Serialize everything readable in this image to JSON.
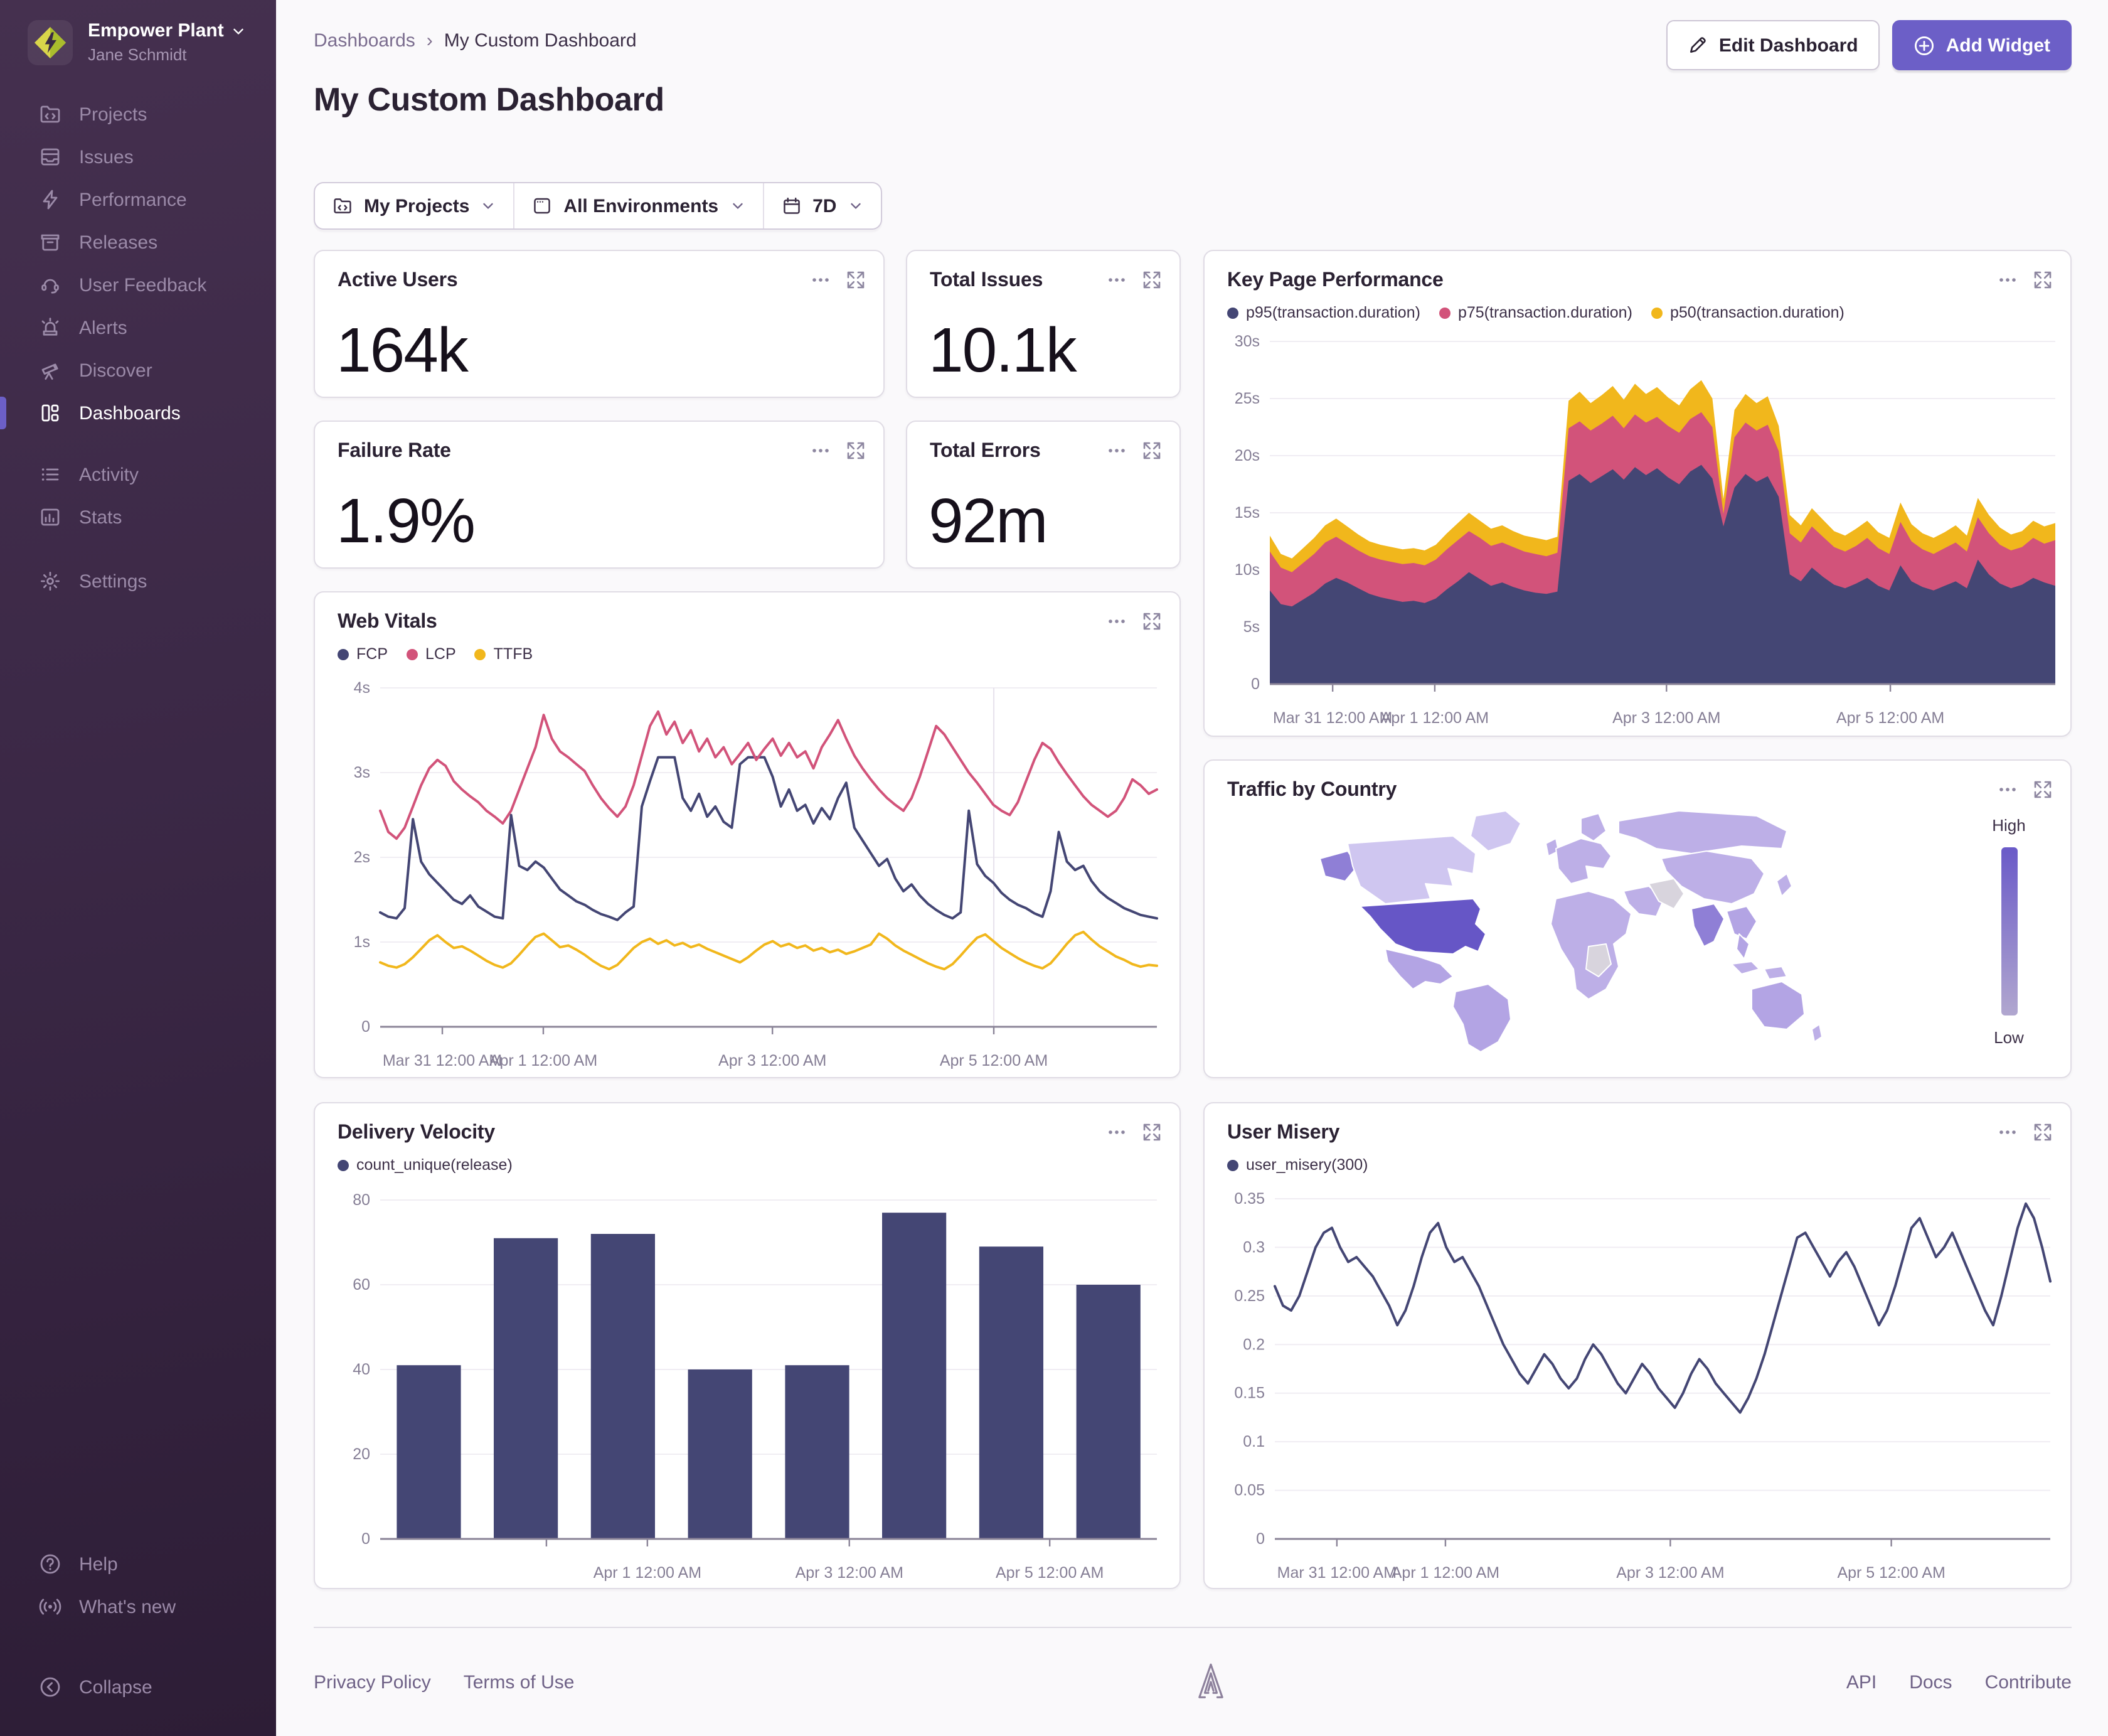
{
  "colors": {
    "accent": "#6c5fc7",
    "text": "#2b2233",
    "muted": "#80708f",
    "link": "#7b6d8f",
    "border": "#e0dce5",
    "axis_label": "#857e95",
    "grid_line": "#f0edf3",
    "baseline": "#8b8498",
    "sb_top": "#45304f",
    "sb_mid": "#3b2846",
    "sb_bottom": "#2d1d36",
    "sb_text": "#9b8aa8",
    "chart_navy": "#444674",
    "chart_pink": "#d2537a",
    "chart_yellow": "#f1b71c",
    "map_none": "#d8d4dd",
    "map_low": "#cfc6f0",
    "map_mid": "#bdafe7",
    "map_mid2": "#b3a4e4",
    "map_high": "#8f7fd6",
    "map_max": "#6656c6",
    "grad_top": "#6a5ac8",
    "grad_bottom": "#b1a7cf"
  },
  "sidebar": {
    "org": "Empower Plant",
    "user": "Jane Schmidt",
    "items": [
      {
        "id": "projects",
        "icon": "folder-code-icon",
        "label": "Projects",
        "active": false
      },
      {
        "id": "issues",
        "icon": "stack-icon",
        "label": "Issues",
        "active": false
      },
      {
        "id": "performance",
        "icon": "lightning-icon",
        "label": "Performance",
        "active": false
      },
      {
        "id": "releases",
        "icon": "archive-icon",
        "label": "Releases",
        "active": false
      },
      {
        "id": "user-feedback",
        "icon": "feedback-icon",
        "label": "User Feedback",
        "active": false
      },
      {
        "id": "alerts",
        "icon": "siren-icon",
        "label": "Alerts",
        "active": false
      },
      {
        "id": "discover",
        "icon": "telescope-icon",
        "label": "Discover",
        "active": false
      },
      {
        "id": "dashboards",
        "icon": "dashboard-icon",
        "label": "Dashboards",
        "active": true
      }
    ],
    "secondary": [
      {
        "id": "activity",
        "icon": "list-icon",
        "label": "Activity",
        "active": false
      },
      {
        "id": "stats",
        "icon": "graph-icon",
        "label": "Stats",
        "active": false
      }
    ],
    "tertiary": [
      {
        "id": "settings",
        "icon": "gear-icon",
        "label": "Settings",
        "active": false
      }
    ],
    "bottom": [
      {
        "id": "help",
        "icon": "help-icon",
        "label": "Help",
        "gap": false
      },
      {
        "id": "whats-new",
        "icon": "broadcast-icon",
        "label": "What's new",
        "gap": false
      },
      {
        "id": "collapse",
        "icon": "collapse-icon",
        "label": "Collapse",
        "gap": true
      }
    ]
  },
  "header": {
    "breadcrumb": [
      "Dashboards",
      "My Custom Dashboard"
    ],
    "breadcrumb_separator": "›",
    "title": "My Custom Dashboard",
    "edit_label": "Edit Dashboard",
    "add_label": "Add Widget"
  },
  "filters": {
    "projects": "My Projects",
    "environments": "All Environments",
    "period": "7D"
  },
  "widgets": {
    "active_users": {
      "title": "Active Users",
      "value": "164k"
    },
    "total_issues": {
      "title": "Total Issues",
      "value": "10.1k"
    },
    "failure_rate": {
      "title": "Failure Rate",
      "value": "1.9%"
    },
    "total_errors": {
      "title": "Total Errors",
      "value": "92m"
    },
    "key_page_performance": {
      "title": "Key Page Performance"
    },
    "web_vitals": {
      "title": "Web Vitals"
    },
    "traffic": {
      "title": "Traffic by Country",
      "legend_high": "High",
      "legend_low": "Low"
    },
    "delivery": {
      "title": "Delivery Velocity"
    },
    "user_misery": {
      "title": "User Misery"
    }
  },
  "chart_data": [
    {
      "id": "key_page_performance",
      "type": "area",
      "title": "Key Page Performance",
      "ylim": [
        0,
        30
      ],
      "yticks": [
        {
          "v": 0,
          "l": "0"
        },
        {
          "v": 5,
          "l": "5s"
        },
        {
          "v": 10,
          "l": "10s"
        },
        {
          "v": 15,
          "l": "15s"
        },
        {
          "v": 20,
          "l": "20s"
        },
        {
          "v": 25,
          "l": "25s"
        },
        {
          "v": 30,
          "l": "30s"
        }
      ],
      "xticks": [
        {
          "f": 0.08,
          "l": "Mar 31 12:00 AM"
        },
        {
          "f": 0.21,
          "l": "Apr 1 12:00 AM"
        },
        {
          "f": 0.505,
          "l": "Apr 3 12:00 AM"
        },
        {
          "f": 0.79,
          "l": "Apr 5 12:00 AM"
        }
      ],
      "series": [
        {
          "name": "p95(transaction.duration)",
          "color": "#444674",
          "values": [
            8.2,
            7.0,
            6.8,
            7.4,
            8.0,
            8.8,
            9.3,
            8.9,
            8.4,
            7.9,
            7.6,
            7.4,
            7.2,
            7.3,
            7.1,
            7.5,
            8.3,
            9.0,
            9.8,
            9.2,
            8.6,
            8.9,
            8.5,
            8.2,
            8.0,
            7.9,
            8.1,
            17.8,
            18.4,
            17.6,
            18.2,
            18.8,
            17.9,
            19.0,
            18.3,
            18.9,
            18.1,
            17.5,
            18.6,
            19.2,
            18.0,
            13.8,
            17.2,
            18.4,
            17.7,
            18.2,
            16.4,
            9.6,
            9.0,
            10.2,
            9.4,
            8.7,
            8.4,
            8.8,
            9.3,
            8.6,
            8.2,
            10.4,
            9.0,
            8.5,
            8.2,
            8.6,
            9.0,
            8.4,
            10.9,
            9.6,
            8.8,
            8.4,
            8.7,
            9.3,
            8.9,
            8.6
          ]
        },
        {
          "name": "p75(transaction.duration)",
          "color": "#d2537a",
          "values": [
            11.6,
            10.2,
            9.8,
            10.6,
            11.4,
            12.4,
            12.9,
            12.3,
            11.7,
            11.2,
            10.9,
            10.7,
            10.5,
            10.6,
            10.4,
            10.9,
            11.8,
            12.6,
            13.4,
            12.8,
            12.1,
            12.4,
            12.0,
            11.6,
            11.4,
            11.2,
            11.5,
            22.4,
            23.0,
            22.2,
            22.8,
            23.5,
            22.4,
            23.6,
            22.9,
            23.4,
            22.6,
            22.0,
            23.2,
            23.8,
            22.5,
            14.9,
            21.6,
            22.9,
            22.2,
            22.7,
            20.4,
            13.2,
            12.4,
            13.8,
            12.9,
            12.0,
            11.6,
            12.1,
            12.8,
            11.9,
            11.4,
            14.2,
            12.5,
            11.8,
            11.4,
            11.9,
            12.4,
            11.6,
            14.6,
            13.2,
            12.2,
            11.7,
            12.0,
            12.8,
            12.3,
            12.6
          ]
        },
        {
          "name": "p50(transaction.duration)",
          "color": "#f1b71c",
          "values": [
            13.0,
            11.4,
            11.0,
            11.9,
            12.8,
            13.9,
            14.5,
            13.8,
            13.1,
            12.5,
            12.2,
            12.0,
            11.8,
            11.9,
            11.7,
            12.2,
            13.2,
            14.1,
            15.0,
            14.3,
            13.6,
            13.9,
            13.4,
            13.0,
            12.8,
            12.6,
            12.9,
            24.8,
            25.6,
            24.6,
            25.3,
            26.1,
            24.9,
            26.3,
            25.4,
            26.0,
            25.1,
            24.4,
            25.8,
            26.6,
            25.0,
            16.2,
            24.0,
            25.4,
            24.6,
            25.2,
            22.6,
            14.8,
            13.9,
            15.4,
            14.4,
            13.4,
            13.0,
            13.6,
            14.3,
            13.3,
            12.8,
            15.9,
            14.0,
            13.2,
            12.8,
            13.3,
            13.9,
            13.0,
            16.3,
            14.8,
            13.7,
            13.1,
            13.4,
            14.3,
            13.8,
            14.1
          ]
        }
      ]
    },
    {
      "id": "web_vitals",
      "type": "line",
      "title": "Web Vitals",
      "ylim": [
        0,
        4
      ],
      "yticks": [
        {
          "v": 0,
          "l": "0"
        },
        {
          "v": 1,
          "l": "1s"
        },
        {
          "v": 2,
          "l": "2s"
        },
        {
          "v": 3,
          "l": "3s"
        },
        {
          "v": 4,
          "l": "4s"
        }
      ],
      "xticks": [
        {
          "f": 0.08,
          "l": "Mar 31 12:00 AM"
        },
        {
          "f": 0.21,
          "l": "Apr 1 12:00 AM"
        },
        {
          "f": 0.505,
          "l": "Apr 3 12:00 AM"
        },
        {
          "f": 0.79,
          "l": "Apr 5 12:00 AM"
        }
      ],
      "vline_f": 0.79,
      "series": [
        {
          "name": "FCP",
          "color": "#444674",
          "values": [
            1.35,
            1.3,
            1.28,
            1.4,
            2.45,
            1.95,
            1.8,
            1.7,
            1.6,
            1.5,
            1.45,
            1.55,
            1.42,
            1.36,
            1.3,
            1.28,
            2.5,
            1.9,
            1.85,
            1.95,
            1.88,
            1.75,
            1.62,
            1.55,
            1.48,
            1.44,
            1.38,
            1.33,
            1.3,
            1.26,
            1.35,
            1.42,
            2.6,
            2.9,
            3.18,
            3.18,
            3.18,
            2.7,
            2.55,
            2.75,
            2.48,
            2.6,
            2.42,
            2.35,
            3.1,
            3.18,
            3.18,
            3.18,
            2.95,
            2.6,
            2.8,
            2.55,
            2.62,
            2.4,
            2.58,
            2.45,
            2.7,
            2.88,
            2.35,
            2.2,
            2.05,
            1.9,
            1.98,
            1.75,
            1.6,
            1.68,
            1.55,
            1.45,
            1.38,
            1.32,
            1.28,
            1.35,
            2.55,
            1.92,
            1.78,
            1.7,
            1.58,
            1.5,
            1.44,
            1.4,
            1.34,
            1.3,
            1.6,
            2.3,
            1.95,
            1.85,
            1.9,
            1.72,
            1.6,
            1.52,
            1.46,
            1.4,
            1.36,
            1.32,
            1.3,
            1.28
          ]
        },
        {
          "name": "LCP",
          "color": "#d2537a",
          "values": [
            2.55,
            2.3,
            2.22,
            2.35,
            2.6,
            2.85,
            3.05,
            3.15,
            3.08,
            2.9,
            2.8,
            2.72,
            2.65,
            2.55,
            2.48,
            2.4,
            2.55,
            2.8,
            3.05,
            3.3,
            3.68,
            3.4,
            3.25,
            3.18,
            3.1,
            3.02,
            2.85,
            2.7,
            2.58,
            2.48,
            2.6,
            2.85,
            3.2,
            3.55,
            3.72,
            3.45,
            3.6,
            3.35,
            3.5,
            3.25,
            3.4,
            3.18,
            3.3,
            3.1,
            3.22,
            3.35,
            3.15,
            3.28,
            3.4,
            3.2,
            3.35,
            3.18,
            3.25,
            3.05,
            3.3,
            3.45,
            3.62,
            3.4,
            3.2,
            3.05,
            2.92,
            2.8,
            2.7,
            2.62,
            2.55,
            2.7,
            2.95,
            3.25,
            3.55,
            3.45,
            3.3,
            3.15,
            3.0,
            2.88,
            2.75,
            2.62,
            2.55,
            2.5,
            2.65,
            2.9,
            3.15,
            3.35,
            3.28,
            3.12,
            2.98,
            2.85,
            2.72,
            2.62,
            2.55,
            2.48,
            2.55,
            2.7,
            2.92,
            2.85,
            2.75,
            2.8
          ]
        },
        {
          "name": "TTFB",
          "color": "#f1b71c",
          "values": [
            0.76,
            0.72,
            0.7,
            0.74,
            0.82,
            0.92,
            1.02,
            1.08,
            1.0,
            0.93,
            0.95,
            0.9,
            0.84,
            0.78,
            0.73,
            0.7,
            0.75,
            0.85,
            0.96,
            1.06,
            1.1,
            1.02,
            0.94,
            0.96,
            0.91,
            0.85,
            0.78,
            0.72,
            0.68,
            0.73,
            0.83,
            0.93,
            1.0,
            1.04,
            0.98,
            1.02,
            0.96,
            0.99,
            0.94,
            0.97,
            0.92,
            0.88,
            0.84,
            0.8,
            0.76,
            0.82,
            0.9,
            0.97,
            1.01,
            0.95,
            0.98,
            0.93,
            0.96,
            0.9,
            0.93,
            0.88,
            0.91,
            0.86,
            0.89,
            0.93,
            0.97,
            1.1,
            1.04,
            0.96,
            0.9,
            0.85,
            0.8,
            0.75,
            0.71,
            0.68,
            0.74,
            0.84,
            0.95,
            1.05,
            1.09,
            1.01,
            0.93,
            0.87,
            0.81,
            0.76,
            0.72,
            0.69,
            0.75,
            0.86,
            0.98,
            1.08,
            1.12,
            1.03,
            0.95,
            0.89,
            0.83,
            0.79,
            0.74,
            0.71,
            0.73,
            0.72
          ]
        }
      ]
    },
    {
      "id": "traffic_by_country",
      "type": "choropleth",
      "title": "Traffic by Country",
      "legend": [
        "High",
        "Low"
      ],
      "highest_traffic_region": "United States"
    },
    {
      "id": "delivery_velocity",
      "type": "bar",
      "title": "Delivery Velocity",
      "ylim": [
        0,
        80
      ],
      "yticks": [
        {
          "v": 0,
          "l": "0"
        },
        {
          "v": 20,
          "l": "20"
        },
        {
          "v": 40,
          "l": "40"
        },
        {
          "v": 60,
          "l": "60"
        },
        {
          "v": 80,
          "l": "80"
        }
      ],
      "xticks": [
        {
          "f": 0.214,
          "l": ""
        },
        {
          "f": 0.344,
          "l": "Apr 1 12:00 AM"
        },
        {
          "f": 0.604,
          "l": "Apr 3 12:00 AM"
        },
        {
          "f": 0.862,
          "l": "Apr 5 12:00 AM"
        }
      ],
      "series": [
        {
          "name": "count_unique(release)",
          "color": "#444674",
          "values": [
            41,
            71,
            72,
            40,
            41,
            77,
            69,
            60
          ]
        }
      ]
    },
    {
      "id": "user_misery",
      "type": "line",
      "title": "User Misery",
      "ylim": [
        0,
        0.35
      ],
      "yticks": [
        {
          "v": 0,
          "l": "0"
        },
        {
          "v": 0.05,
          "l": "0.05"
        },
        {
          "v": 0.1,
          "l": "0.1"
        },
        {
          "v": 0.15,
          "l": "0.15"
        },
        {
          "v": 0.2,
          "l": "0.2"
        },
        {
          "v": 0.25,
          "l": "0.25"
        },
        {
          "v": 0.3,
          "l": "0.3"
        },
        {
          "v": 0.35,
          "l": "0.35"
        }
      ],
      "xticks": [
        {
          "f": 0.08,
          "l": "Mar 31 12:00 AM"
        },
        {
          "f": 0.22,
          "l": "Apr 1 12:00 AM"
        },
        {
          "f": 0.51,
          "l": "Apr 3 12:00 AM"
        },
        {
          "f": 0.795,
          "l": "Apr 5 12:00 AM"
        }
      ],
      "series": [
        {
          "name": "user_misery(300)",
          "color": "#444674",
          "values": [
            0.26,
            0.24,
            0.235,
            0.25,
            0.275,
            0.3,
            0.315,
            0.32,
            0.3,
            0.285,
            0.29,
            0.28,
            0.27,
            0.255,
            0.24,
            0.22,
            0.235,
            0.26,
            0.29,
            0.315,
            0.325,
            0.3,
            0.285,
            0.29,
            0.275,
            0.26,
            0.24,
            0.22,
            0.2,
            0.185,
            0.17,
            0.16,
            0.175,
            0.19,
            0.18,
            0.165,
            0.155,
            0.165,
            0.185,
            0.2,
            0.19,
            0.175,
            0.16,
            0.15,
            0.165,
            0.18,
            0.17,
            0.155,
            0.145,
            0.135,
            0.15,
            0.17,
            0.185,
            0.175,
            0.16,
            0.15,
            0.14,
            0.13,
            0.145,
            0.165,
            0.19,
            0.22,
            0.25,
            0.28,
            0.31,
            0.315,
            0.3,
            0.285,
            0.27,
            0.285,
            0.295,
            0.28,
            0.26,
            0.24,
            0.22,
            0.235,
            0.26,
            0.29,
            0.32,
            0.33,
            0.31,
            0.29,
            0.3,
            0.315,
            0.295,
            0.275,
            0.255,
            0.235,
            0.22,
            0.25,
            0.285,
            0.32,
            0.345,
            0.33,
            0.3,
            0.265
          ]
        }
      ]
    }
  ],
  "footer": {
    "left_links": [
      "Privacy Policy",
      "Terms of Use"
    ],
    "right_links": [
      "API",
      "Docs",
      "Contribute"
    ]
  }
}
